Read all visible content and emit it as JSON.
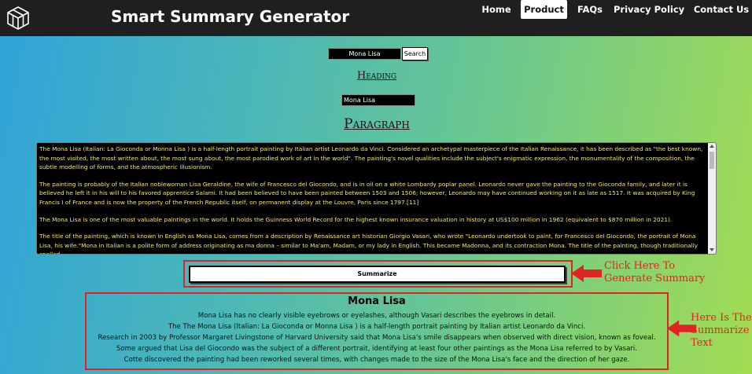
{
  "nav": {
    "logo_icon": "cube-logo-icon",
    "brand": "Smart Summary Generator",
    "links": [
      {
        "label": "Home",
        "active": false
      },
      {
        "label": "Product",
        "active": true
      },
      {
        "label": "FAQs",
        "active": false
      },
      {
        "label": "Privacy Policy",
        "active": false
      },
      {
        "label": "Contact Us",
        "active": false
      }
    ]
  },
  "search": {
    "value": "Mona Lisa",
    "button_label": "Search"
  },
  "heading": {
    "label": "Heading",
    "value": "Mona Lisa"
  },
  "paragraph": {
    "label": "Paragraph",
    "text": [
      "The Mona Lisa (Italian: La Gioconda or Monna Lisa ) is a half-length portrait painting by Italian artist Leonardo da Vinci. Considered an archetypal masterpiece of the Italian Renaissance, it has been described as \"the best known, the most visited, the most written about, the most sung about, the most parodied work of art in the world\". The painting's novel qualities include the subject's enigmatic expression, the monumentality of the composition, the subtle modelling of forms, and the atmospheric illusionism.",
      "The painting is probably of the Italian noblewoman Lisa Geraldine, the wife of Francesco del Giocondo, and is in oil on a white Lombardy poplar panel. Leonardo never gave the painting to the Gioconda family, and later it is believed he left it in his will to his favored apprentice Salami. It had been believed to have been painted between 1503 and 1506; however, Leonardo may have continued working on it as late as 1517. It was acquired by King Francis I of France and is now the property of the French Republic itself, on permanent display at the Louvre, Paris since 1797.[11]",
      "The Mona Lisa is one of the most valuable paintings in the world. It holds the Guinness World Record for the highest known insurance valuation in history at US$100 million in 1962 (equivalent to $870 million in 2021).",
      "The title of the painting, which is known in English as Mona Lisa, comes from a description by Renaissance art historian Giorgio Vasari, who wrote \"Leonardo undertook to paint, for Francesco del Giocondo, the portrait of Mona Lisa, his wife.\"Mona in Italian is a polite form of address originating as ma donna – similar to Ma'am, Madam, or my lady in English. This became Madonna, and its contraction Mona. The title of the painting, though traditionally spelled"
    ]
  },
  "summarize_button": "Summarize",
  "annotations": {
    "button_note_line1": "Click Here To",
    "button_note_line2": "Generate Summary",
    "summary_note_line1": "Here Is The",
    "summary_note_line2": "Summarize",
    "summary_note_line3": "Text",
    "color": "#e02424"
  },
  "summary": {
    "title": "Mona Lisa",
    "lines": [
      "Mona Lisa has no clearly visible eyebrows or eyelashes, although Vasari describes the eyebrows in detail.",
      "The The Mona Lisa (Italian: La Gioconda or Monna Lisa ) is a half-length portrait painting by Italian artist Leonardo da Vinci.",
      "Research in 2003 by Professor Margaret Livingstone of Harvard University said that Mona Lisa's smile disappears when observed with direct vision, known as foveal.",
      "Some argued that Lisa del Giocondo was the subject of a different portrait, identifying at least four other paintings as the Mona Lisa referred to by Vasari.",
      "Cotte discovered the painting had been reworked several times, with changes made to the size of the Mona Lisa's face and the direction of her gaze."
    ]
  }
}
